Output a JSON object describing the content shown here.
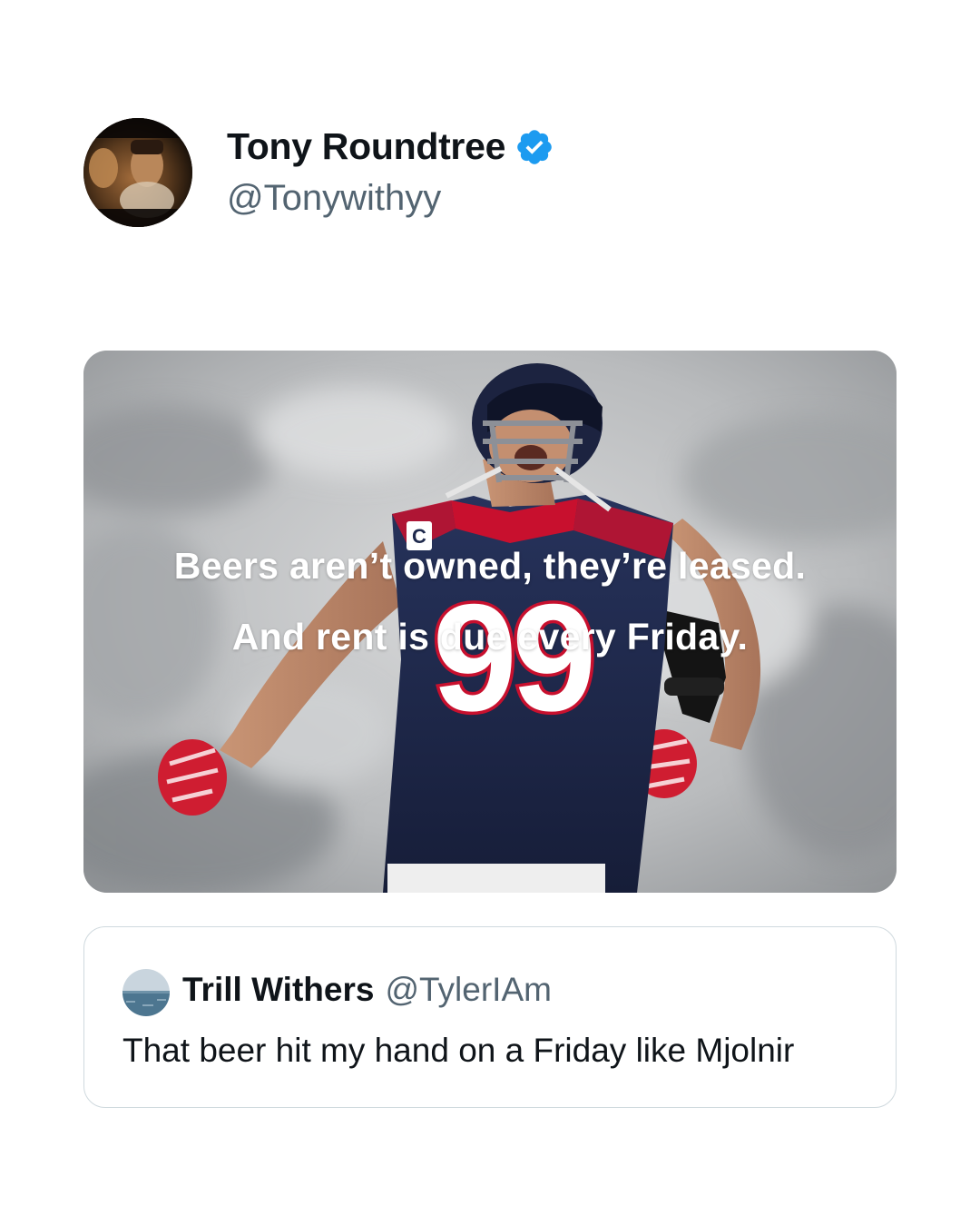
{
  "tweet": {
    "author": {
      "name": "Tony Roundtree",
      "handle": "@Tonywithyy",
      "verified": true,
      "avatar_icon": "avatar-photo"
    },
    "media": {
      "caption_line1": "Beers aren’t owned, they’re leased.",
      "caption_line2": "And rent is due every Friday.",
      "jersey_number": "99",
      "captain_patch": "C"
    },
    "quoted": {
      "name": "Trill Withers",
      "handle": "@TylerIAm",
      "text": "That beer hit my hand on a Friday like Mjolnir",
      "avatar_icon": "ocean-avatar"
    }
  },
  "colors": {
    "verified": "#1d9bf0",
    "handle": "#536471",
    "border": "#cfd9de",
    "jersey_navy": "#1f2a4d",
    "jersey_red": "#c8102e"
  }
}
